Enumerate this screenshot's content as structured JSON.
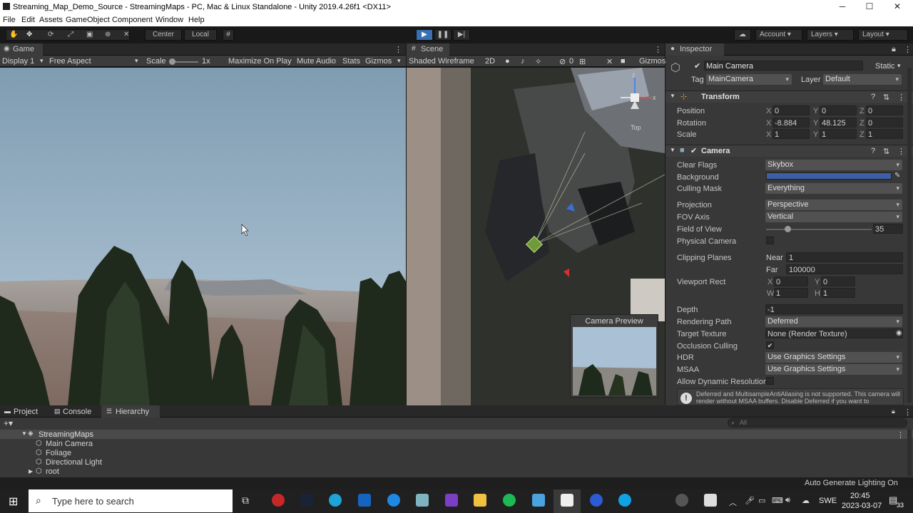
{
  "window": {
    "title": "Streaming_Map_Demo_Source - StreamingMaps - PC, Mac & Linux Standalone - Unity 2019.4.26f1 <DX11>",
    "min": "─",
    "max": "☐",
    "close": "✕"
  },
  "menu": [
    "File",
    "Edit",
    "Assets",
    "GameObject",
    "Component",
    "Window",
    "Help"
  ],
  "toolbar": {
    "center": "Center",
    "local": "Local",
    "account": "Account",
    "layers": "Layers",
    "layout": "Layout"
  },
  "game": {
    "tab": "Game",
    "display": "Display 1",
    "aspect": "Free Aspect",
    "scale_label": "Scale",
    "scale_value": "1x",
    "maximize": "Maximize On Play",
    "mute": "Mute Audio",
    "stats": "Stats",
    "gizmos": "Gizmos"
  },
  "scene": {
    "tab": "Scene",
    "shading": "Shaded Wireframe",
    "mode2d": "2D",
    "hidden_count": "0",
    "gizmos": "Gizmos",
    "axis_view": "Top",
    "camera_preview": "Camera Preview"
  },
  "inspector": {
    "tab": "Inspector",
    "object_name": "Main Camera",
    "static": "Static",
    "tag_label": "Tag",
    "tag": "MainCamera",
    "layer_label": "Layer",
    "layer": "Default",
    "transform": {
      "title": "Transform",
      "position": {
        "label": "Position",
        "x": "0",
        "y": "0",
        "z": "0"
      },
      "rotation": {
        "label": "Rotation",
        "x": "-8.884",
        "y": "48.125",
        "z": "0"
      },
      "scale": {
        "label": "Scale",
        "x": "1",
        "y": "1",
        "z": "1"
      }
    },
    "camera": {
      "title": "Camera",
      "clear_flags_label": "Clear Flags",
      "clear_flags": "Skybox",
      "background_label": "Background",
      "background_color": "#3d5fa8",
      "culling_mask_label": "Culling Mask",
      "culling_mask": "Everything",
      "projection_label": "Projection",
      "projection": "Perspective",
      "fov_axis_label": "FOV Axis",
      "fov_axis": "Vertical",
      "fov_label": "Field of View",
      "fov": "35",
      "fov_fraction": 0.2,
      "physical_label": "Physical Camera",
      "clipping_label": "Clipping Planes",
      "near_label": "Near",
      "near": "1",
      "far_label": "Far",
      "far": "100000",
      "viewport_label": "Viewport Rect",
      "vx": "0",
      "vy": "0",
      "vw": "1",
      "vh": "1",
      "depth_label": "Depth",
      "depth": "-1",
      "rendering_path_label": "Rendering Path",
      "rendering_path": "Deferred",
      "target_texture_label": "Target Texture",
      "target_texture": "None (Render Texture)",
      "occlusion_label": "Occlusion Culling",
      "hdr_label": "HDR",
      "hdr": "Use Graphics Settings",
      "msaa_label": "MSAA",
      "msaa": "Use Graphics Settings",
      "dynres_label": "Allow Dynamic Resolution",
      "warning": "Deferred and MultisampleAntiAliasing is not supported. This camera will render without MSAA buffers. Disable Deferred if you want to"
    }
  },
  "bottom": {
    "tabs": [
      "Project",
      "Console",
      "Hierarchy"
    ],
    "search_placeholder": "All",
    "scene_name": "StreamingMaps",
    "items": [
      "Main Camera",
      "Foliage",
      "Directional Light",
      "root"
    ],
    "status": "Auto Generate Lighting On"
  },
  "taskbar": {
    "search": "Type here to search",
    "lang": "SWE",
    "time": "20:45",
    "date": "2023-03-07",
    "notif": "33"
  }
}
